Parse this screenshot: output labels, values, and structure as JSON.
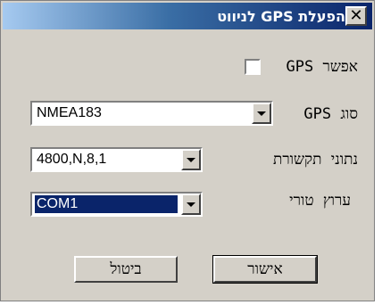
{
  "window": {
    "title": "הפעלת GPS לניווט",
    "close_glyph": "✕"
  },
  "enable_gps": {
    "label": "אפשר GPS",
    "checked": false
  },
  "gps_type": {
    "label": "סוג GPS",
    "value": "NMEA183"
  },
  "comm_params": {
    "label": "נתוני תקשורת",
    "value": "4800,N,8,1"
  },
  "serial_port": {
    "label": "ערוץ טורי",
    "value": "COM1"
  },
  "buttons": {
    "ok": "אישור",
    "cancel": "ביטול"
  },
  "colors": {
    "titlebar_dark": "#0a246a",
    "face": "#d4d0c8",
    "selection": "#0a246a"
  }
}
